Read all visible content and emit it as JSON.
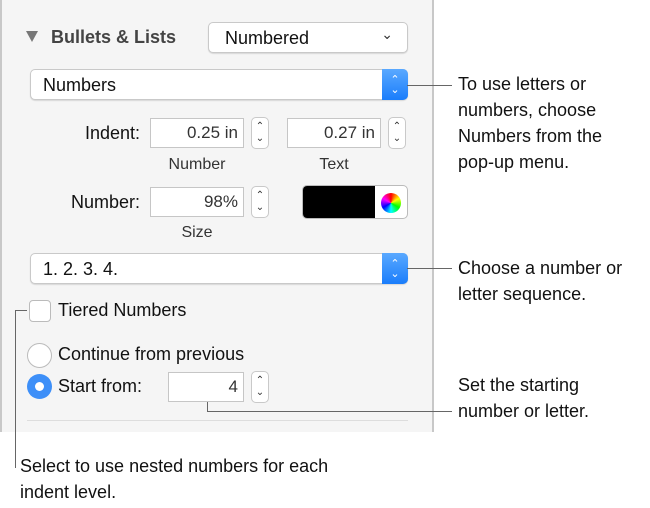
{
  "section": {
    "title": "Bullets & Lists",
    "style_dropdown": "Numbered"
  },
  "list_type_popup": "Numbers",
  "indent": {
    "label": "Indent:",
    "number_value": "0.25 in",
    "text_value": "0.27 in",
    "number_caption": "Number",
    "text_caption": "Text"
  },
  "number_size": {
    "label": "Number:",
    "value": "98%",
    "caption": "Size",
    "color": "#000000"
  },
  "sequence_popup": "1. 2. 3. 4.",
  "tiered": {
    "label": "Tiered Numbers",
    "checked": false
  },
  "numbering": {
    "continue_label": "Continue from previous",
    "start_label": "Start from:",
    "start_value": "4",
    "selected": "start"
  },
  "callouts": [
    "To use letters or numbers, choose Numbers from the pop-up menu.",
    "Choose a number or letter sequence.",
    "Set the starting number or letter.",
    "Select to use nested numbers for each indent level."
  ]
}
